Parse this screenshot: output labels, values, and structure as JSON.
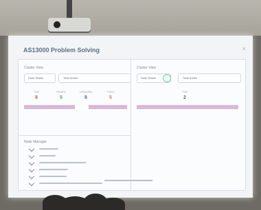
{
  "screen": {
    "title": "AS13000 Problem Solving",
    "close_icon": "×",
    "left_panel_label": "Cluster View",
    "right_panel_label": "Cluster View",
    "metrics": [
      {
        "label": "Total",
        "value": "8",
        "color": "#d14f4a"
      },
      {
        "label": "Healthy",
        "value": "5",
        "color": "#59a861"
      },
      {
        "label": "Unhealthy",
        "value": "8",
        "color": "#5264b8"
      },
      {
        "label": "Failed",
        "value": "5",
        "color": "#c98c46"
      }
    ],
    "section_title": "Node Manager",
    "right_count": "2",
    "accent_bar": "#d8b8d7"
  }
}
